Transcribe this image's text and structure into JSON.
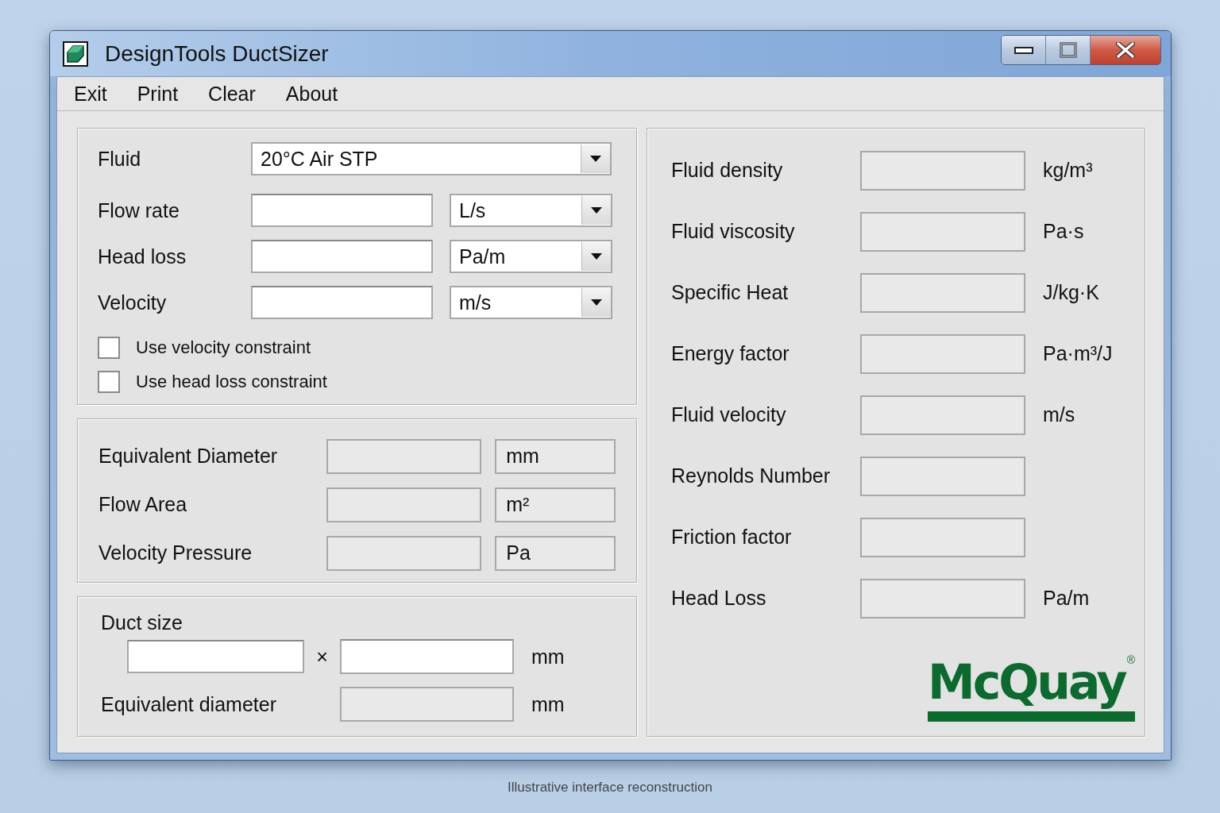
{
  "window": {
    "title": "DesignTools DuctSizer"
  },
  "menu": [
    "Exit",
    "Print",
    "Clear",
    "About"
  ],
  "inputs": {
    "fluid": {
      "label": "Fluid",
      "value": "20°C Air STP"
    },
    "rows": [
      {
        "label": "Flow rate",
        "unit": "L/s"
      },
      {
        "label": "Head loss",
        "unit": "Pa/m"
      },
      {
        "label": "Velocity",
        "unit": "m/s"
      }
    ],
    "checkboxes": [
      {
        "label": "Use velocity constraint",
        "checked": false
      },
      {
        "label": "Use head loss constraint",
        "checked": false
      }
    ]
  },
  "results": [
    {
      "label": "Equivalent Diameter",
      "unit": "mm"
    },
    {
      "label": "Flow Area",
      "unit": "m²"
    },
    {
      "label": "Velocity Pressure",
      "unit": "Pa"
    }
  ],
  "duct_size": {
    "label": "Duct size",
    "separator": "×",
    "unit": "mm",
    "equivalent_label": "Equivalent diameter",
    "equivalent_unit": "mm"
  },
  "properties": [
    {
      "label": "Fluid density",
      "unit": "kg/m³"
    },
    {
      "label": "Fluid viscosity",
      "unit": "Pa·s"
    },
    {
      "label": "Specific Heat",
      "unit": "J/kg·K"
    },
    {
      "label": "Energy factor",
      "unit": "Pa·m³/J"
    },
    {
      "label": "Fluid velocity",
      "unit": "m/s"
    },
    {
      "label": "Reynolds Number"
    },
    {
      "label": "Friction factor"
    },
    {
      "label": "Head Loss",
      "unit": "Pa/m"
    }
  ],
  "logo": {
    "text": "McQuay",
    "mark": "®"
  },
  "caption": "Illustrative interface reconstruction"
}
